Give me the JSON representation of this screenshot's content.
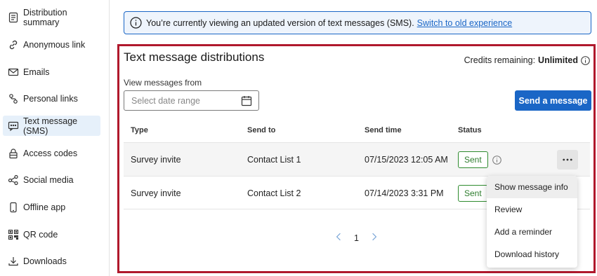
{
  "sidebar": {
    "items": [
      {
        "label": "Distribution summary",
        "icon": "document-list-icon"
      },
      {
        "label": "Anonymous link",
        "icon": "link-icon"
      },
      {
        "label": "Emails",
        "icon": "envelope-icon"
      },
      {
        "label": "Personal links",
        "icon": "personal-link-icon"
      },
      {
        "label": "Text message (SMS)",
        "icon": "chat-bubble-icon",
        "active": true
      },
      {
        "label": "Access codes",
        "icon": "lock-icon"
      },
      {
        "label": "Social media",
        "icon": "share-icon"
      },
      {
        "label": "Offline app",
        "icon": "phone-icon"
      },
      {
        "label": "QR code",
        "icon": "qr-code-icon"
      },
      {
        "label": "Downloads",
        "icon": "download-icon"
      }
    ]
  },
  "banner": {
    "text": "You’re currently viewing an updated version of text messages (SMS).",
    "link": "Switch to old experience"
  },
  "main": {
    "title": "Text message distributions",
    "credits_label": "Credits remaining:",
    "credits_value": "Unlimited",
    "view_label": "View messages from",
    "date_placeholder": "Select date range",
    "send_button": "Send a message"
  },
  "table": {
    "headers": [
      "Type",
      "Send to",
      "Send time",
      "Status"
    ],
    "rows": [
      {
        "type": "Survey invite",
        "send_to": "Contact List 1",
        "send_time": "07/15/2023 12:05 AM",
        "status": "Sent"
      },
      {
        "type": "Survey invite",
        "send_to": "Contact List 2",
        "send_time": "07/14/2023 3:31 PM",
        "status": "Sent"
      }
    ]
  },
  "pagination": {
    "page": "1"
  },
  "context_menu": {
    "items": [
      "Show message info",
      "Review",
      "Add a reminder",
      "Download history"
    ]
  },
  "colors": {
    "accent": "#1a66c6",
    "highlight_border": "#b0182c",
    "sent_green": "#2e7d2e"
  }
}
